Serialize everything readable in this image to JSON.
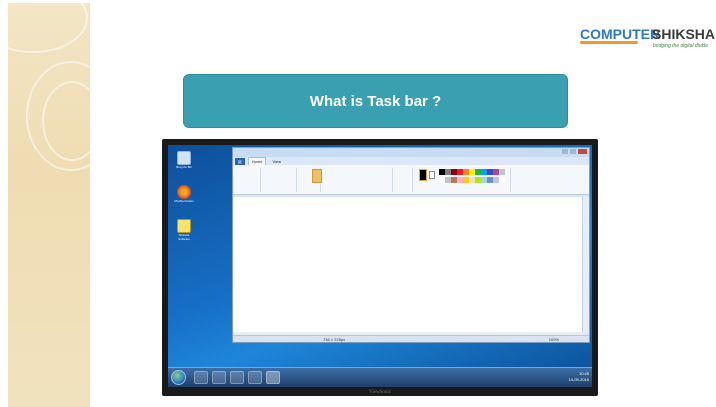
{
  "logo": {
    "word1": "COMPUTER",
    "word2": "SHIKSHA",
    "tagline": "bridging the digital divide"
  },
  "title": "What is Task bar ?",
  "monitor": {
    "brand": "ViewSonic",
    "desktop_icons": [
      {
        "label": "Recycle Bin",
        "icon": "recycle-bin-icon"
      },
      {
        "label": "Mozilla Firefox",
        "icon": "firefox-icon"
      },
      {
        "label": "Shiksha Software",
        "icon": "shiksha-icon"
      }
    ],
    "paint": {
      "tabs": [
        "Home",
        "View"
      ],
      "active_tab": "Home",
      "status_text": "736 × 378px",
      "zoom": "100%"
    },
    "taskbar": {
      "time": "10:45",
      "date": "14-09-2016"
    }
  },
  "colors": {
    "title_box": "#3a9fb0",
    "logo_blue": "#2e78c4",
    "logo_orange": "#f29a1f",
    "strip": "#f1e2bf"
  }
}
